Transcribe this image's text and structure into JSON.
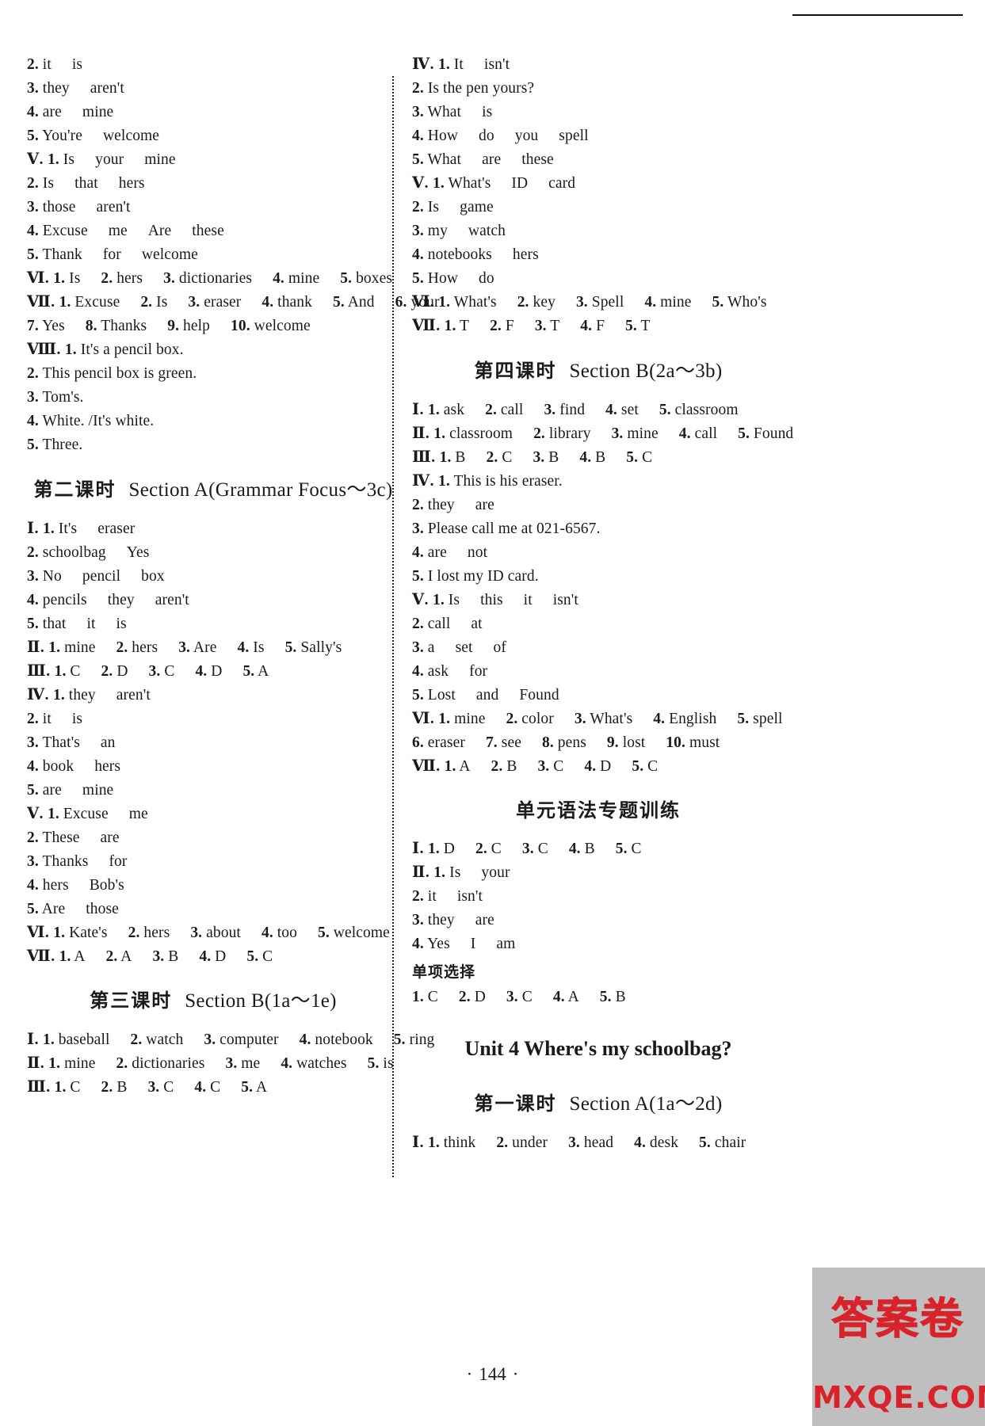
{
  "page": {
    "folio": "144",
    "watermark_seal": "答案卷",
    "watermark_site": "MXQE.COM"
  },
  "left_column": {
    "blocks": [
      {
        "type": "answers",
        "lines": [
          "2. it   is",
          "3. they   aren't",
          "4. are   mine",
          "5. You're   welcome",
          "Ⅴ. 1. Is   your   mine",
          "2. Is   that   hers",
          "3. those   aren't",
          "4. Excuse   me   Are   these",
          "5. Thank   for   welcome",
          "Ⅵ. 1. Is   2. hers   3. dictionaries   4. mine   5. boxes",
          "Ⅶ. 1. Excuse   2. Is   3. eraser   4. thank   5. And   6. your",
          "7. Yes   8. Thanks   9. help   10. welcome",
          "Ⅷ. 1. It's a pencil box.",
          "2. This pencil box is green.",
          "3. Tom's.",
          "4. White. /It's white.",
          "5. Three."
        ]
      },
      {
        "type": "heading",
        "cn": "第二课时",
        "en": "Section A(Grammar Focus～3c)"
      },
      {
        "type": "answers",
        "lines": [
          "Ⅰ. 1. It's   eraser",
          "2. schoolbag   Yes",
          "3. No   pencil   box",
          "4. pencils   they   aren't",
          "5. that   it   is",
          "Ⅱ. 1. mine   2. hers   3. Are   4. Is   5. Sally's",
          "Ⅲ. 1. C   2. D   3. C   4. D   5. A",
          "Ⅳ. 1. they   aren't",
          "2. it   is",
          "3. That's   an",
          "4. book   hers",
          "5. are   mine",
          "Ⅴ. 1. Excuse   me",
          "2. These   are",
          "3. Thanks   for",
          "4. hers   Bob's",
          "5. Are   those",
          "Ⅵ. 1. Kate's   2. hers   3. about   4. too   5. welcome",
          "Ⅶ. 1. A   2. A   3. B   4. D   5. C"
        ]
      },
      {
        "type": "heading",
        "cn": "第三课时",
        "en": "Section B(1a～1e)"
      },
      {
        "type": "answers",
        "lines": [
          "Ⅰ. 1. baseball   2. watch   3. computer   4. notebook   5. ring",
          "Ⅱ. 1. mine   2. dictionaries   3. me   4. watches   5. is",
          "Ⅲ. 1. C   2. B   3. C   4. C   5. A"
        ]
      }
    ]
  },
  "right_column": {
    "blocks": [
      {
        "type": "answers",
        "lines": [
          "Ⅳ. 1. It   isn't",
          "2. Is the pen yours?",
          "3. What   is",
          "4. How   do   you   spell",
          "5. What   are   these",
          "Ⅴ. 1. What's   ID   card",
          "2. Is   game",
          "3. my   watch",
          "4. notebooks   hers",
          "5. How   do",
          "Ⅵ. 1. What's   2. key   3. Spell   4. mine   5. Who's",
          "Ⅶ. 1. T   2. F   3. T   4. F   5. T"
        ]
      },
      {
        "type": "heading",
        "cn": "第四课时",
        "en": "Section B(2a～3b)"
      },
      {
        "type": "answers",
        "lines": [
          "Ⅰ. 1. ask   2. call   3. find   4. set   5. classroom",
          "Ⅱ. 1. classroom   2. library   3. mine   4. call   5. Found",
          "Ⅲ. 1. B   2. C   3. B   4. B   5. C",
          "Ⅳ. 1. This is his eraser.",
          "2. they   are",
          "3. Please call me at 021-6567.",
          "4. are   not",
          "5. I lost my ID card.",
          "Ⅴ. 1. Is   this   it   isn't",
          "2. call   at",
          "3. a   set   of",
          "4. ask   for",
          "5. Lost   and   Found",
          "Ⅵ. 1. mine   2. color   3. What's   4. English   5. spell",
          "6. eraser   7. see   8. pens   9. lost   10. must",
          "Ⅶ. 1. A   2. B   3. C   4. D   5. C"
        ]
      },
      {
        "type": "heading_cn_only",
        "cn": "单元语法专题训练"
      },
      {
        "type": "answers",
        "lines": [
          "Ⅰ. 1. D   2. C   3. C   4. B   5. C",
          "Ⅱ. 1. Is   your",
          "2. it   isn't",
          "3. they   are",
          "4. Yes   I   am"
        ]
      },
      {
        "type": "subhead",
        "cn": "单项选择"
      },
      {
        "type": "answers",
        "lines": [
          "1. C   2. D   3. C   4. A   5. B"
        ]
      },
      {
        "type": "unit_heading",
        "text": "Unit 4   Where's my schoolbag?"
      },
      {
        "type": "heading",
        "cn": "第一课时",
        "en": "Section A(1a～2d)"
      },
      {
        "type": "answers",
        "lines": [
          "Ⅰ. 1. think   2. under   3. head   4. desk   5. chair"
        ]
      }
    ]
  }
}
